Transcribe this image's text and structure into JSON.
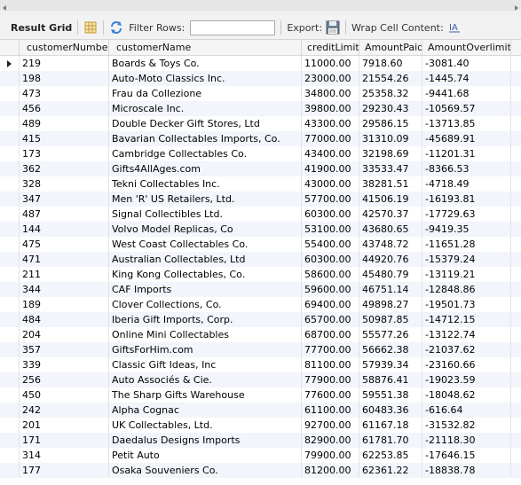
{
  "toolbar": {
    "title": "Result Grid",
    "filter_label": "Filter Rows:",
    "filter_value": "",
    "export_label": "Export:",
    "wrap_label": "Wrap Cell Content:",
    "icons": [
      "grid-layout-icon",
      "refresh-icon",
      "export-save-icon",
      "wrap-text-icon"
    ],
    "accent_color": "#3b7fd6"
  },
  "columns": [
    "customerNumber",
    "customerName",
    "creditLimit",
    "AmountPaid",
    "AmountOverlimit"
  ],
  "rows": [
    [
      "219",
      "Boards & Toys Co.",
      "11000.00",
      "7918.60",
      "-3081.40"
    ],
    [
      "198",
      "Auto-Moto Classics Inc.",
      "23000.00",
      "21554.26",
      "-1445.74"
    ],
    [
      "473",
      "Frau da Collezione",
      "34800.00",
      "25358.32",
      "-9441.68"
    ],
    [
      "456",
      "Microscale Inc.",
      "39800.00",
      "29230.43",
      "-10569.57"
    ],
    [
      "489",
      "Double Decker Gift Stores, Ltd",
      "43300.00",
      "29586.15",
      "-13713.85"
    ],
    [
      "415",
      "Bavarian Collectables Imports, Co.",
      "77000.00",
      "31310.09",
      "-45689.91"
    ],
    [
      "173",
      "Cambridge Collectables Co.",
      "43400.00",
      "32198.69",
      "-11201.31"
    ],
    [
      "362",
      "Gifts4AllAges.com",
      "41900.00",
      "33533.47",
      "-8366.53"
    ],
    [
      "328",
      "Tekni Collectables Inc.",
      "43000.00",
      "38281.51",
      "-4718.49"
    ],
    [
      "347",
      "Men 'R' US Retailers, Ltd.",
      "57700.00",
      "41506.19",
      "-16193.81"
    ],
    [
      "487",
      "Signal Collectibles Ltd.",
      "60300.00",
      "42570.37",
      "-17729.63"
    ],
    [
      "144",
      "Volvo Model Replicas, Co",
      "53100.00",
      "43680.65",
      "-9419.35"
    ],
    [
      "475",
      "West Coast Collectables Co.",
      "55400.00",
      "43748.72",
      "-11651.28"
    ],
    [
      "471",
      "Australian Collectables, Ltd",
      "60300.00",
      "44920.76",
      "-15379.24"
    ],
    [
      "211",
      "King Kong Collectables, Co.",
      "58600.00",
      "45480.79",
      "-13119.21"
    ],
    [
      "344",
      "CAF Imports",
      "59600.00",
      "46751.14",
      "-12848.86"
    ],
    [
      "189",
      "Clover Collections, Co.",
      "69400.00",
      "49898.27",
      "-19501.73"
    ],
    [
      "484",
      "Iberia Gift Imports, Corp.",
      "65700.00",
      "50987.85",
      "-14712.15"
    ],
    [
      "204",
      "Online Mini Collectables",
      "68700.00",
      "55577.26",
      "-13122.74"
    ],
    [
      "357",
      "GiftsForHim.com",
      "77700.00",
      "56662.38",
      "-21037.62"
    ],
    [
      "339",
      "Classic Gift Ideas, Inc",
      "81100.00",
      "57939.34",
      "-23160.66"
    ],
    [
      "256",
      "Auto Associés & Cie.",
      "77900.00",
      "58876.41",
      "-19023.59"
    ],
    [
      "450",
      "The Sharp Gifts Warehouse",
      "77600.00",
      "59551.38",
      "-18048.62"
    ],
    [
      "242",
      "Alpha Cognac",
      "61100.00",
      "60483.36",
      "-616.64"
    ],
    [
      "201",
      "UK Collectables, Ltd.",
      "92700.00",
      "61167.18",
      "-31532.82"
    ],
    [
      "171",
      "Daedalus Designs Imports",
      "82900.00",
      "61781.70",
      "-21118.30"
    ],
    [
      "314",
      "Petit Auto",
      "79900.00",
      "62253.85",
      "-17646.15"
    ],
    [
      "177",
      "Osaka Souveniers Co.",
      "81200.00",
      "62361.22",
      "-18838.78"
    ]
  ]
}
